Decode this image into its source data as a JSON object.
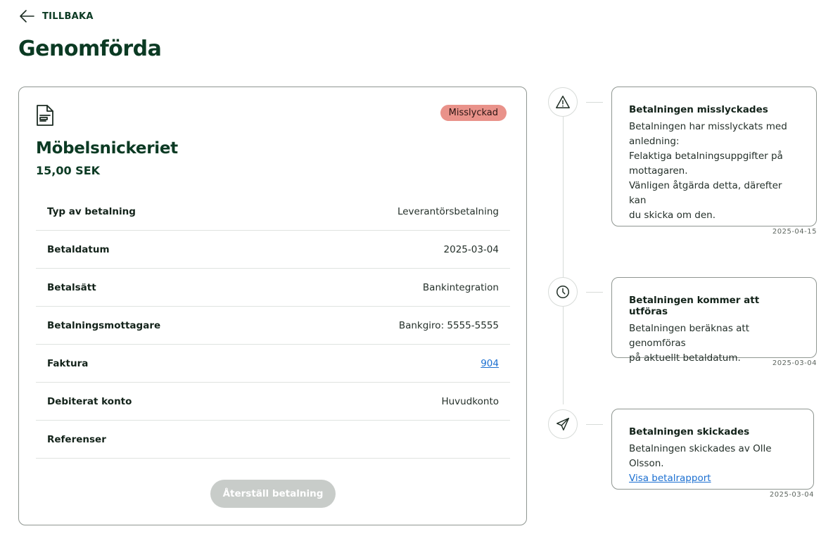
{
  "nav": {
    "back_label": "TILLBAKA"
  },
  "page": {
    "title": "Genomförda"
  },
  "payment": {
    "status": "Misslyckad",
    "payee": "Möbelsnickeriet",
    "amount": "15,00 SEK",
    "rows": [
      {
        "label": "Typ av betalning",
        "value": "Leverantörsbetalning"
      },
      {
        "label": "Betaldatum",
        "value": "2025-03-04"
      },
      {
        "label": "Betalsätt",
        "value": "Bankintegration"
      },
      {
        "label": "Betalningsmottagare",
        "value": "Bankgiro: 5555-5555"
      },
      {
        "label": "Faktura",
        "value": "904"
      },
      {
        "label": "Debiterat konto",
        "value": "Huvudkonto"
      },
      {
        "label": "Referenser",
        "value": ""
      }
    ],
    "restore_label": "Återställ betalning"
  },
  "timeline": [
    {
      "icon": "warning-icon",
      "title": "Betalningen misslyckades",
      "body": "Betalningen har misslyckats med\nanledning:\nFelaktiga betalningsuppgifter på\nmottagaren.\nVänligen åtgärda detta, därefter kan\ndu skicka om den.",
      "date": "2025-04-15"
    },
    {
      "icon": "clock-icon",
      "title": "Betalningen kommer att utföras",
      "body": "Betalningen beräknas att genomföras\npå aktuellt betaldatum.",
      "date": "2025-03-04"
    },
    {
      "icon": "send-icon",
      "title": "Betalningen skickades",
      "body": "Betalningen skickades av Olle Olsson.",
      "link": "Visa betalrapport",
      "date": "2025-03-04"
    }
  ],
  "colors": {
    "brand": "#0b3a23",
    "status_failed": "#e9928a",
    "link": "#1b6fd1",
    "button_disabled": "#c8ccc9"
  }
}
